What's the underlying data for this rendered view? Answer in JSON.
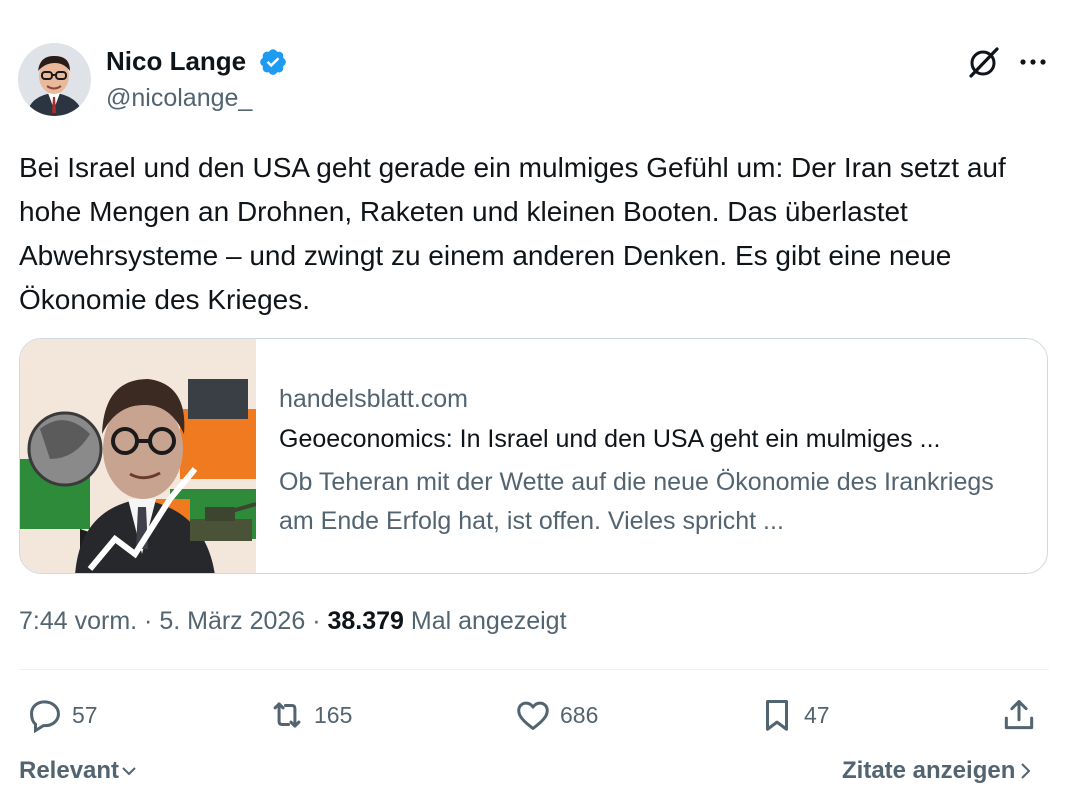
{
  "author": {
    "name": "Nico Lange",
    "handle": "@nicolange_",
    "verified_icon": "verified-badge-icon",
    "verified_color": "#1d9bf0"
  },
  "tweet": {
    "text": "Bei Israel und den USA geht gerade ein mulmiges Gefühl um: Der Iran setzt auf hohe Mengen an Drohnen, Raketen und kleinen Booten. Das überlastet Abwehrsysteme – und zwingt zu einem anderen Denken. Es gibt eine neue Ökonomie des Krieges."
  },
  "link_card": {
    "domain": "handelsblatt.com",
    "title": "Geoeconomics: In Israel und den USA geht ein mulmiges ...",
    "description": "Ob Teheran mit der Wette auf die neue Ökonomie des Irankriegs am Ende Erfolg hat, ist offen. Vieles spricht ..."
  },
  "meta": {
    "time": "7:44 vorm.",
    "separator": " · ",
    "date": "5. März 2026",
    "views_count": "38.379",
    "views_label": " Mal angezeigt"
  },
  "actions": {
    "replies": "57",
    "retweets": "165",
    "likes": "686",
    "bookmarks": "47"
  },
  "footer": {
    "sort_label": "Relevant",
    "quotes_label": "Zitate anzeigen"
  },
  "colors": {
    "text": "#0f1419",
    "secondary": "#536471",
    "border": "#cfd9de",
    "card_green": "#2e8b3a",
    "card_orange": "#f07a1f",
    "card_bg": "#f3e7dc"
  }
}
